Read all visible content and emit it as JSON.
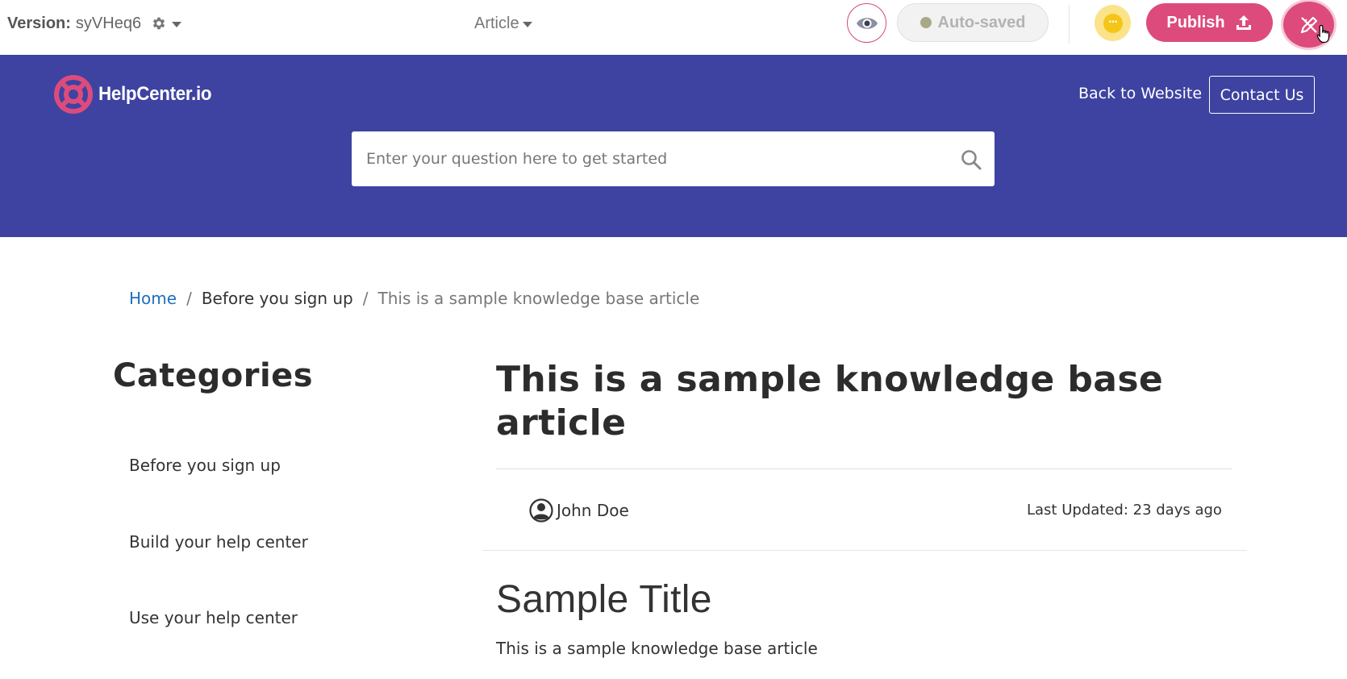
{
  "toolbar": {
    "version_label": "Version:",
    "version_value": "syVHeq6",
    "article_menu": "Article",
    "autosaved_label": "Auto-saved",
    "more_glyph": "···",
    "publish_label": "Publish"
  },
  "header": {
    "brand_name": "HelpCenter.io",
    "back_link": "Back to Website",
    "contact_button": "Contact Us",
    "search_placeholder": "Enter your question here to get started"
  },
  "breadcrumb": {
    "home": "Home",
    "separator": "/",
    "category": "Before you sign up",
    "current": "This is a sample knowledge base article"
  },
  "sidebar": {
    "title": "Categories",
    "items": [
      {
        "label": "Before you sign up"
      },
      {
        "label": "Build your help center"
      },
      {
        "label": "Use your help center"
      }
    ]
  },
  "article": {
    "title": "This is a sample knowledge base article",
    "author": "John Doe",
    "last_updated": "Last Updated: 23 days ago",
    "content_heading": "Sample Title",
    "content_body": "This is a sample knowledge base article"
  },
  "colors": {
    "hero_background": "#3e43a1",
    "brand_pink": "#dd4b7d",
    "link_blue": "#1f6fbf",
    "status_dot": "#a9a98a",
    "more_button_bg": "#fbe38a"
  }
}
